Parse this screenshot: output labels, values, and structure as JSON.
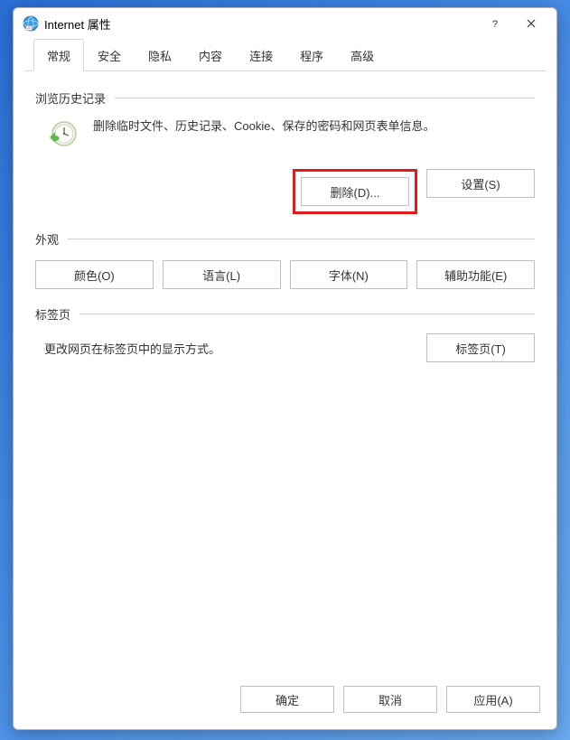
{
  "titlebar": {
    "title": "Internet 属性",
    "help_label": "?",
    "close_label": "×"
  },
  "tabs": [
    {
      "label": "常规",
      "active": true
    },
    {
      "label": "安全",
      "active": false
    },
    {
      "label": "隐私",
      "active": false
    },
    {
      "label": "内容",
      "active": false
    },
    {
      "label": "连接",
      "active": false
    },
    {
      "label": "程序",
      "active": false
    },
    {
      "label": "高级",
      "active": false
    }
  ],
  "history_group": {
    "title": "浏览历史记录",
    "desc": "删除临时文件、历史记录、Cookie、保存的密码和网页表单信息。",
    "delete_btn": "删除(D)...",
    "settings_btn": "设置(S)"
  },
  "appearance_group": {
    "title": "外观",
    "colors_btn": "颜色(O)",
    "lang_btn": "语言(L)",
    "fonts_btn": "字体(N)",
    "access_btn": "辅助功能(E)"
  },
  "tabs_group": {
    "title": "标签页",
    "desc": "更改网页在标签页中的显示方式。",
    "tabs_btn": "标签页(T)"
  },
  "footer": {
    "ok": "确定",
    "cancel": "取消",
    "apply": "应用(A)"
  }
}
